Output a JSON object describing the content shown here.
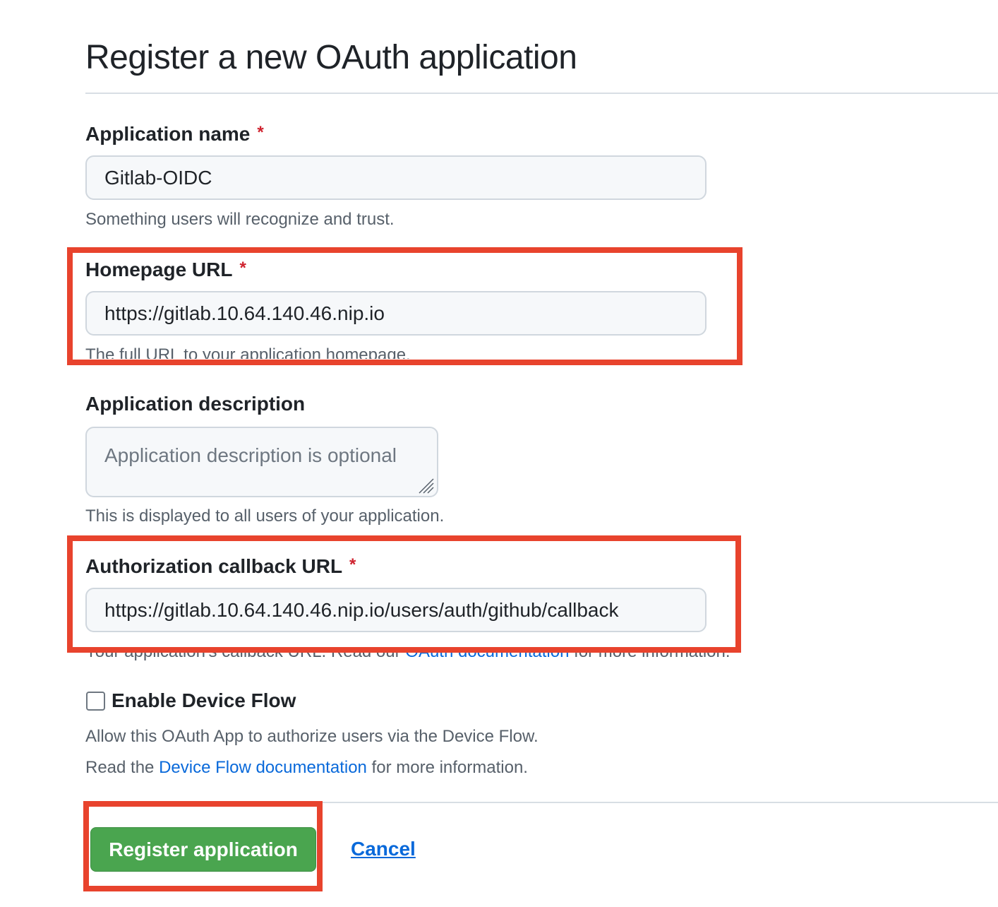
{
  "page": {
    "title": "Register a new OAuth application"
  },
  "form": {
    "app_name": {
      "label": "Application name",
      "required_mark": "*",
      "value": "Gitlab-OIDC",
      "note": "Something users will recognize and trust."
    },
    "homepage_url": {
      "label": "Homepage URL",
      "required_mark": "*",
      "value": "https://gitlab.10.64.140.46.nip.io",
      "note": "The full URL to your application homepage."
    },
    "description": {
      "label": "Application description",
      "placeholder": "Application description is optional",
      "note": "This is displayed to all users of your application."
    },
    "callback_url": {
      "label": "Authorization callback URL",
      "required_mark": "*",
      "value": "https://gitlab.10.64.140.46.nip.io/users/auth/github/callback",
      "note_prefix": "Your application's callback URL. Read our ",
      "note_link": "OAuth documentation",
      "note_suffix": " for more information."
    },
    "device_flow": {
      "label": "Enable Device Flow",
      "checked": false,
      "note": "Allow this OAuth App to authorize users via the Device Flow.",
      "read_prefix": "Read the ",
      "read_link": "Device Flow documentation",
      "read_suffix": " for more information."
    }
  },
  "actions": {
    "register_label": "Register application",
    "cancel_label": "Cancel"
  },
  "colors": {
    "highlight": "#e8432d",
    "primary_button": "#4aa54f",
    "link": "#0969da",
    "required": "#cf222e"
  }
}
